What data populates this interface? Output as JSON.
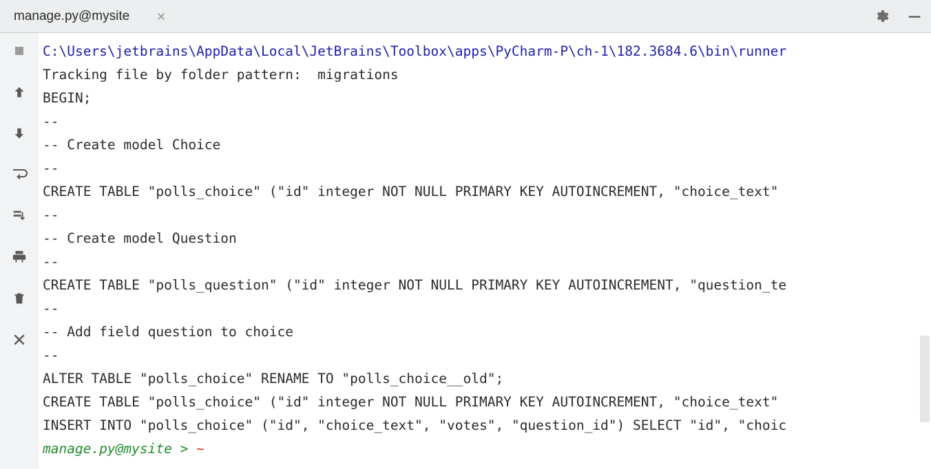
{
  "tab": {
    "title": "manage.py@mysite"
  },
  "icons": {
    "gear": "gear-icon",
    "minimize": "minimize-icon",
    "stop": "stop-icon",
    "up": "arrow-up-icon",
    "down": "arrow-down-icon",
    "softwrap": "softwrap-icon",
    "scrolltoend": "scroll-to-end-icon",
    "print": "print-icon",
    "trash": "trash-icon",
    "close": "close-icon"
  },
  "output": {
    "path": "C:\\Users\\jetbrains\\AppData\\Local\\JetBrains\\Toolbox\\apps\\PyCharm-P\\ch-1\\182.3684.6\\bin\\runner",
    "lines": [
      "Tracking file by folder pattern:  migrations",
      "BEGIN;",
      "--",
      "-- Create model Choice",
      "--",
      "CREATE TABLE \"polls_choice\" (\"id\" integer NOT NULL PRIMARY KEY AUTOINCREMENT, \"choice_text\" ",
      "--",
      "-- Create model Question",
      "--",
      "CREATE TABLE \"polls_question\" (\"id\" integer NOT NULL PRIMARY KEY AUTOINCREMENT, \"question_te",
      "--",
      "-- Add field question to choice",
      "--",
      "ALTER TABLE \"polls_choice\" RENAME TO \"polls_choice__old\";",
      "CREATE TABLE \"polls_choice\" (\"id\" integer NOT NULL PRIMARY KEY AUTOINCREMENT, \"choice_text\" ",
      "INSERT INTO \"polls_choice\" (\"id\", \"choice_text\", \"votes\", \"question_id\") SELECT \"id\", \"choic"
    ]
  },
  "prompt": {
    "text": "manage.py@mysite > "
  }
}
